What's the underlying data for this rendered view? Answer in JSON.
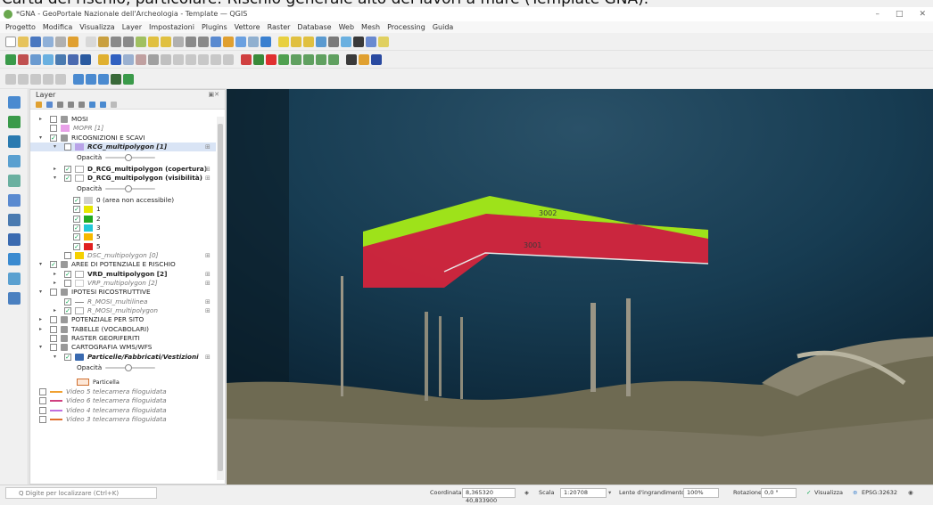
{
  "caption": "Carta del rischio, particolare: Rischio generale alto dei lavori a mare (Template GNA).",
  "window": {
    "title": "*GNA - GeoPortale Nazionale dell'Archeologia - Template — QGIS"
  },
  "menu": [
    "Progetto",
    "Modifica",
    "Visualizza",
    "Layer",
    "Impostazioni",
    "Plugins",
    "Vettore",
    "Raster",
    "Database",
    "Web",
    "Mesh",
    "Processing",
    "Guida"
  ],
  "layer_panel": {
    "title": "Layer",
    "opacity_label": "Opacità",
    "tree": {
      "mosi": "MOSI",
      "mopr": "MOPR [1]",
      "ricognizioni": "RICOGNIZIONI E SCAVI",
      "rcg": "RCG_multipolygon [1]",
      "d_rcg_cop": "D_RCG_multipolygon (copertura)",
      "d_rcg_vis": "D_RCG_multipolygon (visibilità)",
      "cat0": "0 (area non accessibile)",
      "cat1": "1",
      "cat2": "2",
      "cat3": "3",
      "cat4": "5",
      "cat5": "5",
      "dsc": "DSC_multipolygon [0]",
      "aree": "AREE DI POTENZIALE E RISCHIO",
      "vrd": "VRD_multipolygon [2]",
      "vrp": "VRP_multipolygon [2]",
      "ipotesi": "IPOTESI RICOSTRUTTIVE",
      "r_mosi_line": "R_MOSI_multilinea",
      "r_mosi_poly": "R_MOSI_multipolygon",
      "potenziale": "POTENZIALE PER SITO",
      "tabelle": "TABELLE (VOCABOLARI)",
      "raster": "RASTER GEORIFERITI",
      "cartografia": "CARTOGRAFIA WMS/WFS",
      "particelle": "Particelle/Fabbricati/Vestizioni",
      "partlegend": "Particella",
      "v5": "Video 5 telecamera filoguidata",
      "v6": "Video 6 telecamera filoguidata",
      "v4": "Video 4 telecamera filoguidata",
      "v3": "Video 3 telecamera filoguidata"
    },
    "colors": {
      "mopr": "#e8a0e8",
      "rcg": "#b9a3e8",
      "cat0": "#d0d0d0",
      "cat1": "#e6e600",
      "cat2": "#22aa22",
      "cat3": "#22c8d8",
      "cat4": "#f5b800",
      "cat5": "#e02020",
      "dsc": "#f5d000",
      "v5": "#f0a030",
      "v6": "#d04080",
      "v4": "#c070e0",
      "v3": "#e07030"
    }
  },
  "map": {
    "label_green": "3002",
    "label_red": "3001",
    "green_color": "#9ee21a",
    "red_color": "#d9243c"
  },
  "status": {
    "locator_placeholder": "Q  Digite per localizzare (Ctrl+K)",
    "coord_label": "Coordinata",
    "coord_value": "8,365320 40,833900",
    "scale_label": "Scala",
    "scale_value": "1:20708",
    "magnifier_label": "Lente d'ingrandimento",
    "magnifier_value": "100%",
    "rotation_label": "Rotazione",
    "rotation_value": "0,0 °",
    "render_label": "Visualizza",
    "crs": "EPSG:32632"
  }
}
